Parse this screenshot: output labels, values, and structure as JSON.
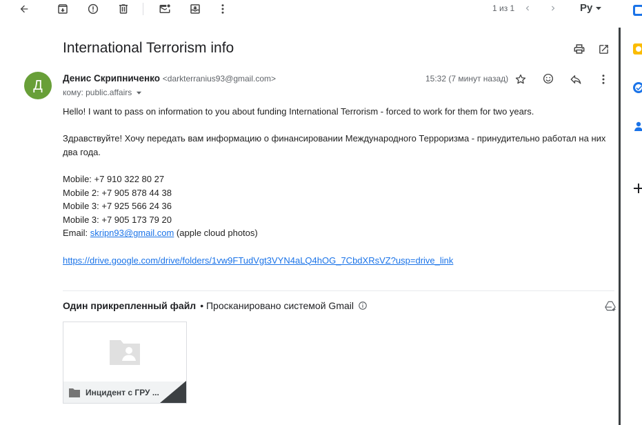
{
  "toolbar": {
    "back": "arrow-back-icon",
    "archive": "archive-icon",
    "spam": "report-spam-icon",
    "delete": "delete-icon",
    "mark_unread": "mark-unread-icon",
    "move": "move-to-icon",
    "more": "more-vert-icon"
  },
  "pager": {
    "text": "1 из 1"
  },
  "lang": {
    "label": "Ру"
  },
  "email": {
    "subject": "International Terrorism info",
    "avatar_letter": "Д",
    "avatar_color": "#689f38",
    "sender_name": "Денис Скрипниченко",
    "sender_email": "<darkterranius93@gmail.com>",
    "to": "кому: public.affairs",
    "time": "15:32 (7 минут назад)",
    "body": {
      "p1": "Hello! I want to pass on information to you about funding International Terrorism - forced to work for them for two years.",
      "p2": "Здравствуйте! Хочу передать вам информацию о финансировании Международного Терроризма - принудительно работал на них два года.",
      "mobile1": "Mobile: +7 910 322 80 27",
      "mobile2": "Mobile 2: +7 905 878 44 38",
      "mobile3a": "Mobile 3: +7 925 566 24 36",
      "mobile3b": "Mobile 3: +7 905 173 79 20",
      "email_label": "Email: ",
      "email_link": "skripn93@gmail.com",
      "email_note": " (apple cloud photos)",
      "drive_link": "https://drive.google.com/drive/folders/1vw9FTudVgt3VYN4aLQ4hOG_7CbdXRsVZ?usp=drive_link"
    }
  },
  "attachments": {
    "title": "Один прикрепленный файл",
    "scanned": "• Просканировано системой Gmail",
    "file_name": "Инцидент с ГРУ ..."
  },
  "colors": {
    "link": "#1a73e8",
    "accent_green": "#689f38"
  }
}
